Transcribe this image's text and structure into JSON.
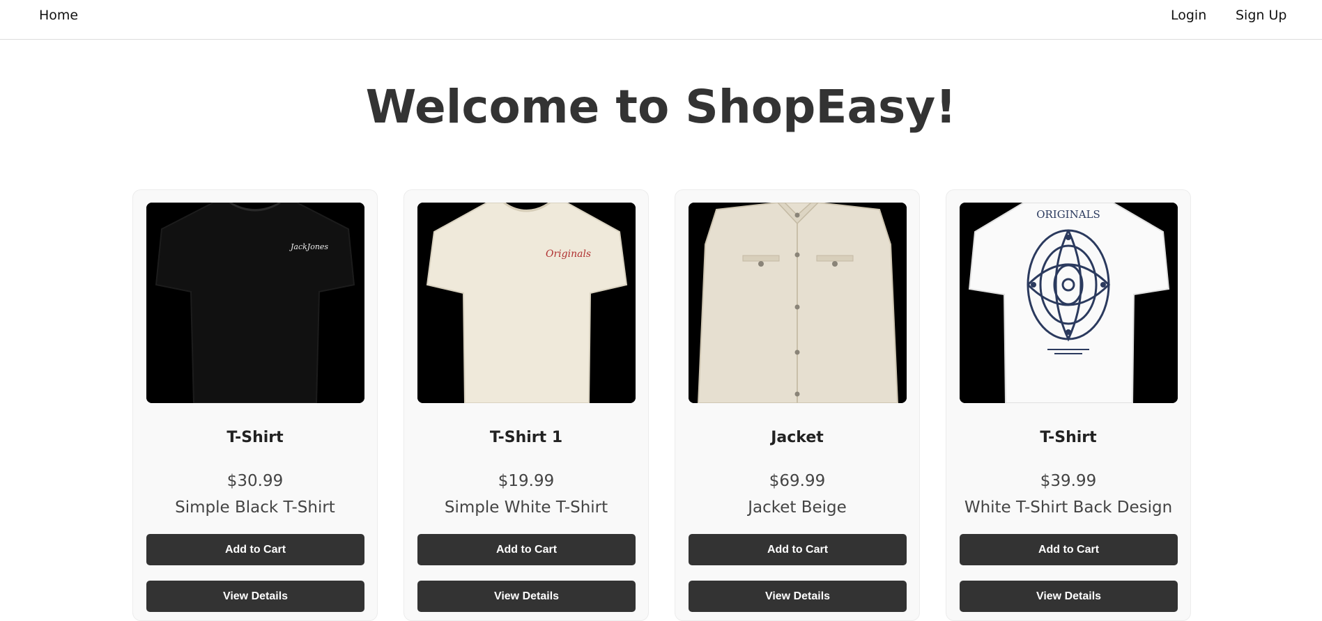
{
  "nav": {
    "home": "Home",
    "login": "Login",
    "signup": "Sign Up"
  },
  "page": {
    "title": "Welcome to ShopEasy!"
  },
  "products": [
    {
      "name": "T-Shirt",
      "price": "$30.99",
      "description": "Simple Black T-Shirt",
      "add_to_cart": "Add to Cart",
      "view_details": "View Details",
      "image_color": "#111111",
      "print_text": "JackJones"
    },
    {
      "name": "T-Shirt 1",
      "price": "$19.99",
      "description": "Simple White T-Shirt",
      "add_to_cart": "Add to Cart",
      "view_details": "View Details",
      "image_color": "#efe9da",
      "print_text": "Originals"
    },
    {
      "name": "Jacket",
      "price": "$69.99",
      "description": "Jacket Beige",
      "add_to_cart": "Add to Cart",
      "view_details": "View Details",
      "image_color": "#e6dfd0"
    },
    {
      "name": "T-Shirt",
      "price": "$39.99",
      "description": "White T-Shirt Back Design",
      "add_to_cart": "Add to Cart",
      "view_details": "View Details",
      "image_color": "#fafafa",
      "print_text": "ORIGINALS"
    }
  ],
  "colors": {
    "button_bg": "#333333",
    "card_bg": "#f9f9f9",
    "image_bg": "#000000"
  }
}
